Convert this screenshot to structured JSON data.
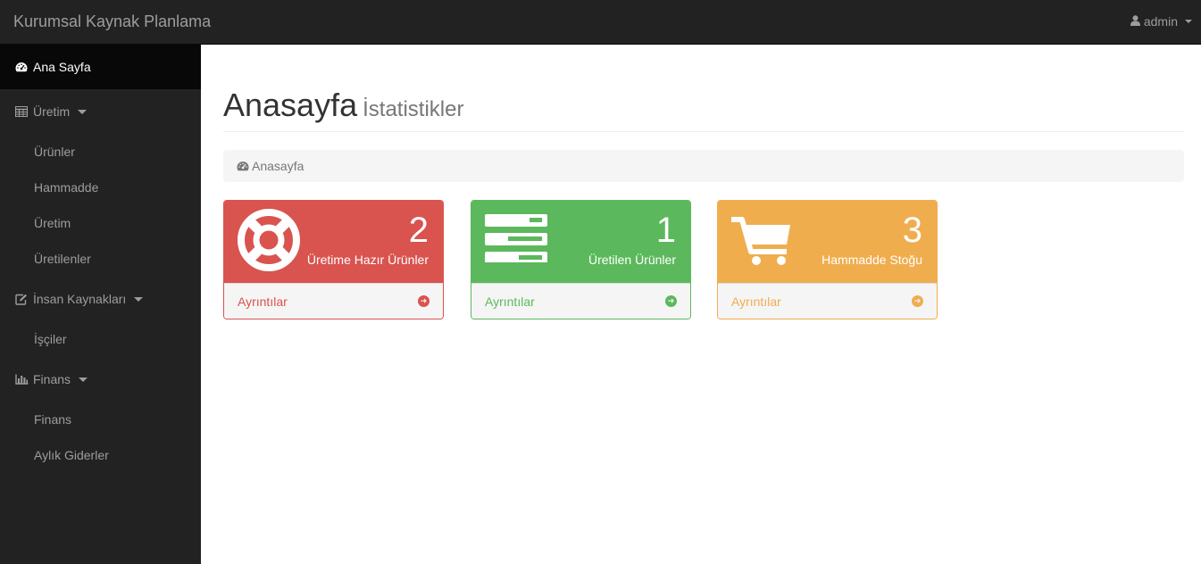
{
  "navbar": {
    "brand": "Kurumsal Kaynak Planlama",
    "user": "admin"
  },
  "sidebar": {
    "items": [
      {
        "label": "Ana Sayfa",
        "icon": "dashboard-icon",
        "active": true
      },
      {
        "label": "Üretim",
        "icon": "table-icon",
        "dropdown": true,
        "children": [
          "Ürünler",
          "Hammadde",
          "Üretim",
          "Üretilenler"
        ]
      },
      {
        "label": "İnsan Kaynakları",
        "icon": "edit-icon",
        "dropdown": true,
        "children": [
          "İşçiler"
        ]
      },
      {
        "label": "Finans",
        "icon": "bar-chart-icon",
        "dropdown": true,
        "children": [
          "Finans",
          "Aylık Giderler"
        ]
      }
    ]
  },
  "main": {
    "title": "Anasayfa",
    "subtitle": "İstatistikler",
    "breadcrumb": "Anasayfa",
    "panels": [
      {
        "count": "2",
        "label": "Üretime Hazır Ürünler",
        "footer": "Ayrıntılar",
        "icon": "life-ring-icon",
        "color": "#d9534f"
      },
      {
        "count": "1",
        "label": "Üretilen Ürünler",
        "footer": "Ayrıntılar",
        "icon": "tasks-icon",
        "color": "#5cb85c"
      },
      {
        "count": "3",
        "label": "Hammadde Stoğu",
        "footer": "Ayrıntılar",
        "icon": "shopping-cart-icon",
        "color": "#f0ad4e"
      }
    ]
  },
  "colors": {
    "navbar_bg": "#222222",
    "sidebar_active_bg": "#080808",
    "danger": "#d9534f",
    "success": "#5cb85c",
    "warning": "#f0ad4e"
  }
}
